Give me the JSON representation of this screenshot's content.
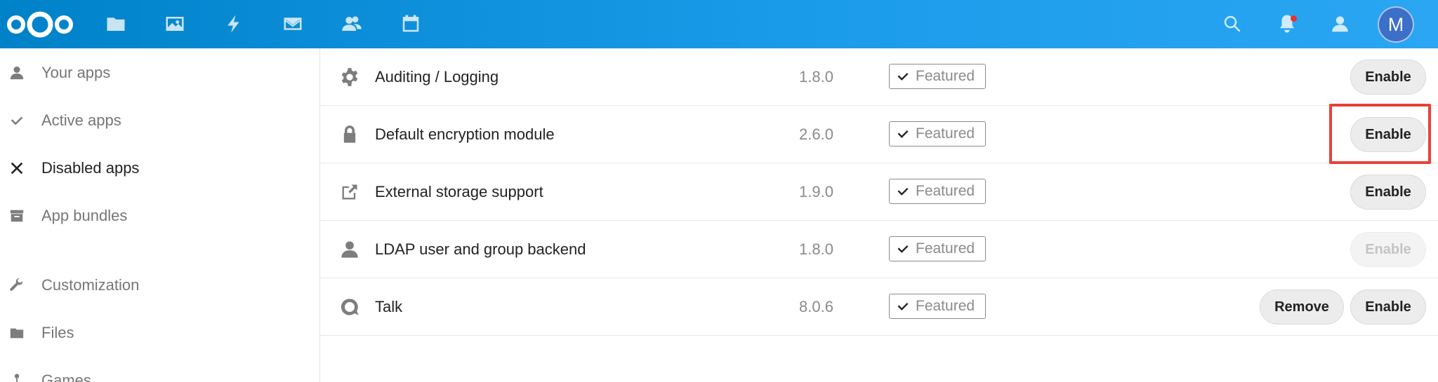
{
  "header": {
    "logo": "nextcloud-logo",
    "nav_icons": [
      "files-icon",
      "photos-icon",
      "activity-icon",
      "mail-icon",
      "contacts-icon",
      "calendar-icon"
    ],
    "right_icons": [
      "search-icon",
      "notifications-icon",
      "contacts-menu-icon"
    ],
    "avatar_initial": "M",
    "brand_color": "#0082c9"
  },
  "sidebar": {
    "items": [
      {
        "label": "Your apps",
        "icon": "user-icon",
        "active": false
      },
      {
        "label": "Active apps",
        "icon": "check-icon",
        "active": false
      },
      {
        "label": "Disabled apps",
        "icon": "close-icon",
        "active": true
      },
      {
        "label": "App bundles",
        "icon": "archive-icon",
        "active": false
      },
      {
        "label": "Customization",
        "icon": "wrench-icon",
        "active": false
      },
      {
        "label": "Files",
        "icon": "folder-icon",
        "active": false
      },
      {
        "label": "Games",
        "icon": "joystick-icon",
        "active": false
      }
    ]
  },
  "apps": [
    {
      "name": "Auditing / Logging",
      "icon": "gear-icon",
      "version": "1.8.0",
      "badge": "Featured",
      "enable_label": "Enable",
      "enable_disabled": false
    },
    {
      "name": "Default encryption module",
      "icon": "lock-icon",
      "version": "2.6.0",
      "badge": "Featured",
      "enable_label": "Enable",
      "enable_disabled": false
    },
    {
      "name": "External storage support",
      "icon": "external-link-icon",
      "version": "1.9.0",
      "badge": "Featured",
      "enable_label": "Enable",
      "enable_disabled": false
    },
    {
      "name": "LDAP user and group backend",
      "icon": "user-icon",
      "version": "1.8.0",
      "badge": "Featured",
      "enable_label": "Enable",
      "enable_disabled": true
    },
    {
      "name": "Talk",
      "icon": "talk-icon",
      "version": "8.0.6",
      "badge": "Featured",
      "enable_label": "Enable",
      "remove_label": "Remove",
      "enable_disabled": false
    }
  ],
  "highlight_color": "#e8413a"
}
